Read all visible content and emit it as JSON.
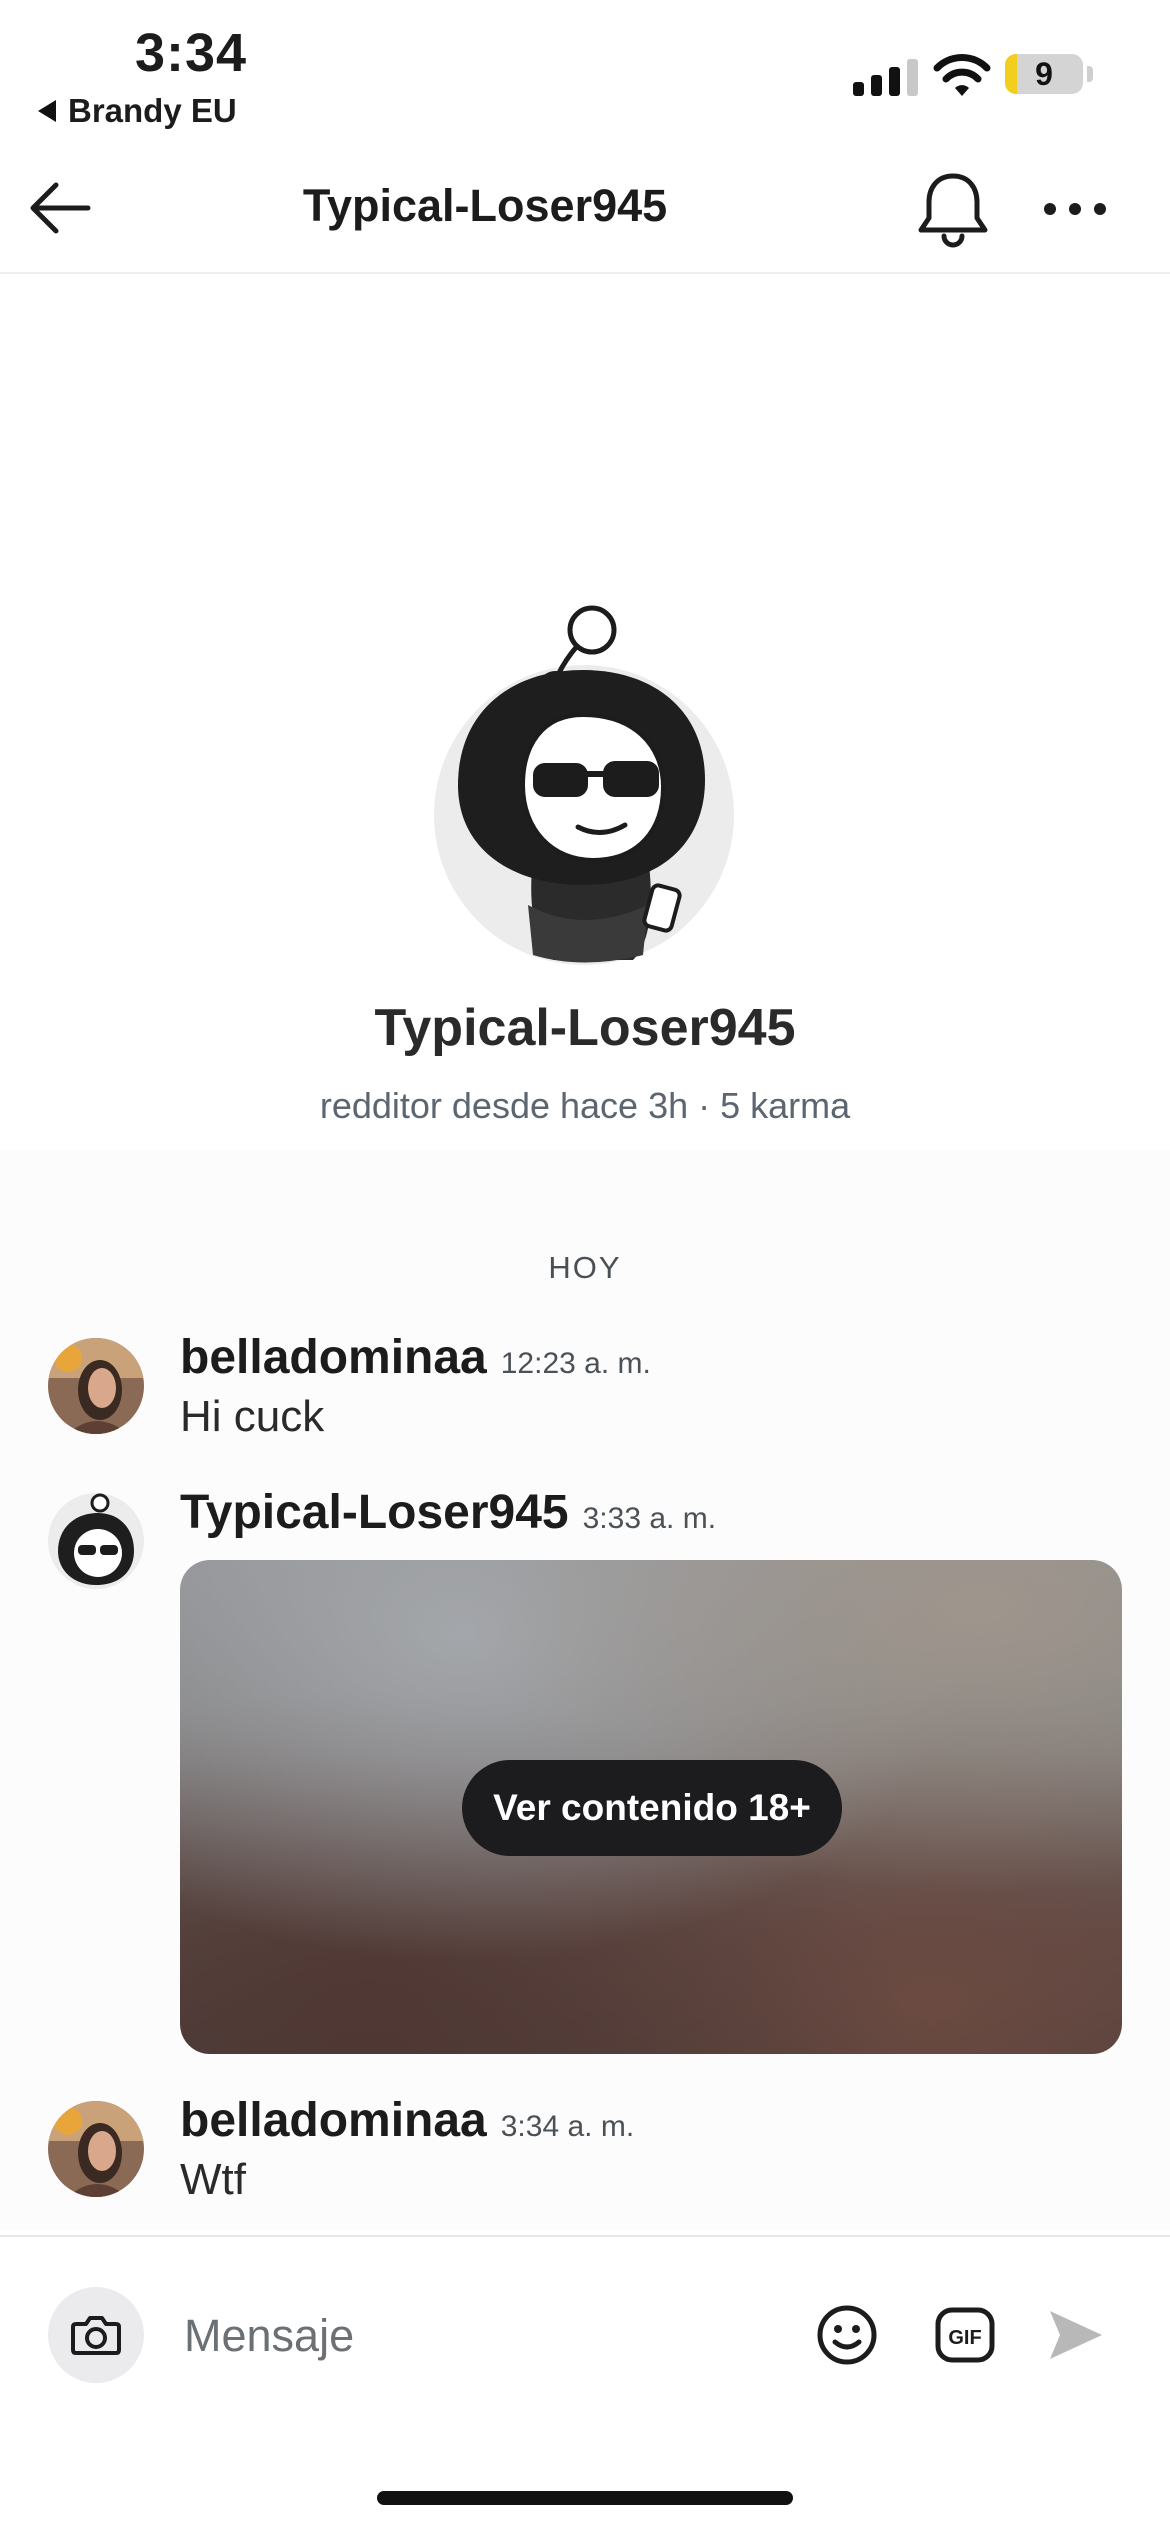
{
  "status_bar": {
    "time": "3:34",
    "back_app": "Brandy EU",
    "battery": "9"
  },
  "header": {
    "title": "Typical-Loser945",
    "icons": [
      "arrow-left-icon",
      "bell-icon",
      "more-horizontal-icon"
    ]
  },
  "profile": {
    "username": "Typical-Loser945",
    "meta": "redditor desde hace 3h · 5 karma"
  },
  "conversation": {
    "date_label": "HOY",
    "messages": [
      {
        "author": "belladominaa",
        "time": "12:23 a. m.",
        "text": "Hi cuck"
      },
      {
        "author": "Typical-Loser945",
        "time": "3:33 a. m.",
        "media_button": "Ver contenido 18+"
      },
      {
        "author": "belladominaa",
        "time": "3:34 a. m.",
        "text": "Wtf"
      }
    ]
  },
  "composer": {
    "placeholder": "Mensaje",
    "icons": [
      "camera-icon",
      "emoji-icon",
      "gif-icon",
      "send-icon"
    ]
  },
  "colors": {
    "accent_battery": "#f2cf1f",
    "nsfw_button_bg": "#1c1c1e",
    "meta_text": "#5c6670"
  }
}
